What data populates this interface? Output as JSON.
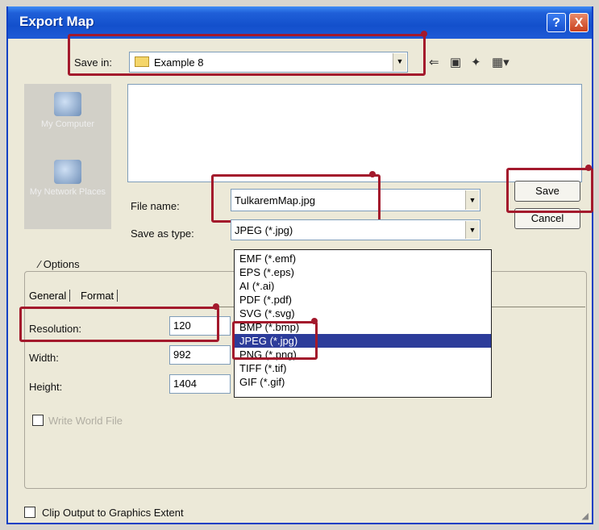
{
  "window": {
    "title": "Export Map",
    "help_glyph": "?",
    "close_glyph": "X"
  },
  "save_in": {
    "label": "Save in:",
    "value": "Example 8"
  },
  "toolbar_icons": [
    "back-icon",
    "up-folder-icon",
    "new-folder-icon",
    "view-menu-icon"
  ],
  "places": [
    {
      "label": "My Computer"
    },
    {
      "label": "My Network Places"
    }
  ],
  "file_name": {
    "label": "File name:",
    "value": "TulkaremMap.jpg"
  },
  "save_as_type": {
    "label": "Save as type:",
    "value": "JPEG (*.jpg)",
    "options": [
      "EMF (*.emf)",
      "EPS (*.eps)",
      "AI (*.ai)",
      "PDF (*.pdf)",
      "SVG (*.svg)",
      "BMP (*.bmp)",
      "JPEG (*.jpg)",
      "PNG (*.png)",
      "TIFF (*.tif)",
      "GIF (*.gif)"
    ],
    "selected_index": 6
  },
  "buttons": {
    "save": "Save",
    "cancel": "Cancel"
  },
  "options_group": {
    "label": "Options"
  },
  "tabs": {
    "general": "General",
    "format": "Format"
  },
  "fields": {
    "resolution": {
      "label": "Resolution:",
      "value": "120"
    },
    "width": {
      "label": "Width:",
      "value": "992"
    },
    "height": {
      "label": "Height:",
      "value": "1404"
    }
  },
  "world_file": {
    "label": "Write World File",
    "checked": false
  },
  "clip_output": {
    "label": "Clip Output to Graphics Extent",
    "checked": false
  },
  "colors": {
    "title_bar": "#1350cc",
    "highlight": "#a3192c",
    "selection": "#2c3c9a",
    "dialog_bg": "#ece9d8"
  }
}
